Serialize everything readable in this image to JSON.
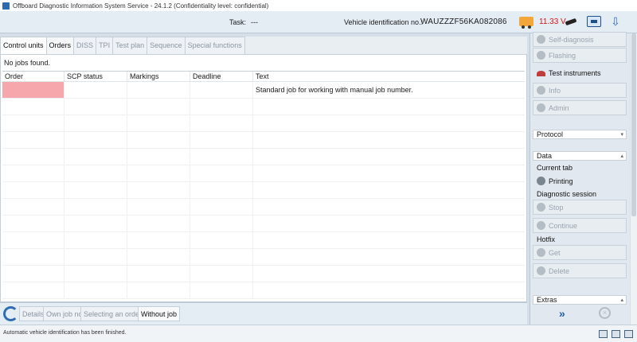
{
  "window": {
    "title": "Offboard Diagnostic Information System Service - 24.1.2 (Confidentiality level: confidential)"
  },
  "status": {
    "task_label": "Task:",
    "task_value": "---",
    "vin_label": "Vehicle identification no.:",
    "vin_value": "WAUZZZF56KA082086",
    "voltage": "11.33 V"
  },
  "tabs": [
    {
      "label": "Control units",
      "state": "active"
    },
    {
      "label": "Orders",
      "state": "enabled"
    },
    {
      "label": "DISS",
      "state": "disabled"
    },
    {
      "label": "TPI",
      "state": "disabled"
    },
    {
      "label": "Test plan",
      "state": "disabled"
    },
    {
      "label": "Sequence",
      "state": "disabled"
    },
    {
      "label": "Special functions",
      "state": "disabled"
    }
  ],
  "main": {
    "message": "No jobs found.",
    "columns": [
      "Order",
      "SCP status",
      "Markings",
      "Deadline",
      "Text"
    ],
    "rows": [
      {
        "order": "",
        "scp_status": "",
        "markings": "",
        "deadline": "",
        "text": "Standard job for working with manual job number."
      }
    ]
  },
  "bottom_buttons": [
    {
      "label": "Details",
      "enabled": false
    },
    {
      "label": "Own job no.",
      "enabled": false
    },
    {
      "label": "Selecting an order",
      "enabled": false
    },
    {
      "label": "Without job",
      "enabled": true
    }
  ],
  "panel": {
    "self_diagnosis": "Self-diagnosis",
    "flashing": "Flashing",
    "test_instruments": "Test instruments",
    "info": "Info",
    "admin": "Admin",
    "protocol": "Protocol",
    "data": "Data",
    "current_tab": "Current tab",
    "printing": "Printing",
    "diagnostic_session": "Diagnostic session",
    "stop": "Stop",
    "continue": "Continue",
    "hotfix": "Hotfix",
    "get": "Get",
    "delete": "Delete",
    "extras": "Extras"
  },
  "footer": {
    "message": "Automatic vehicle identification has been finished."
  },
  "colors": {
    "selected_cell": "#f5a7ab",
    "voltage_text": "#d01818",
    "accent_blue": "#2d6db5"
  }
}
